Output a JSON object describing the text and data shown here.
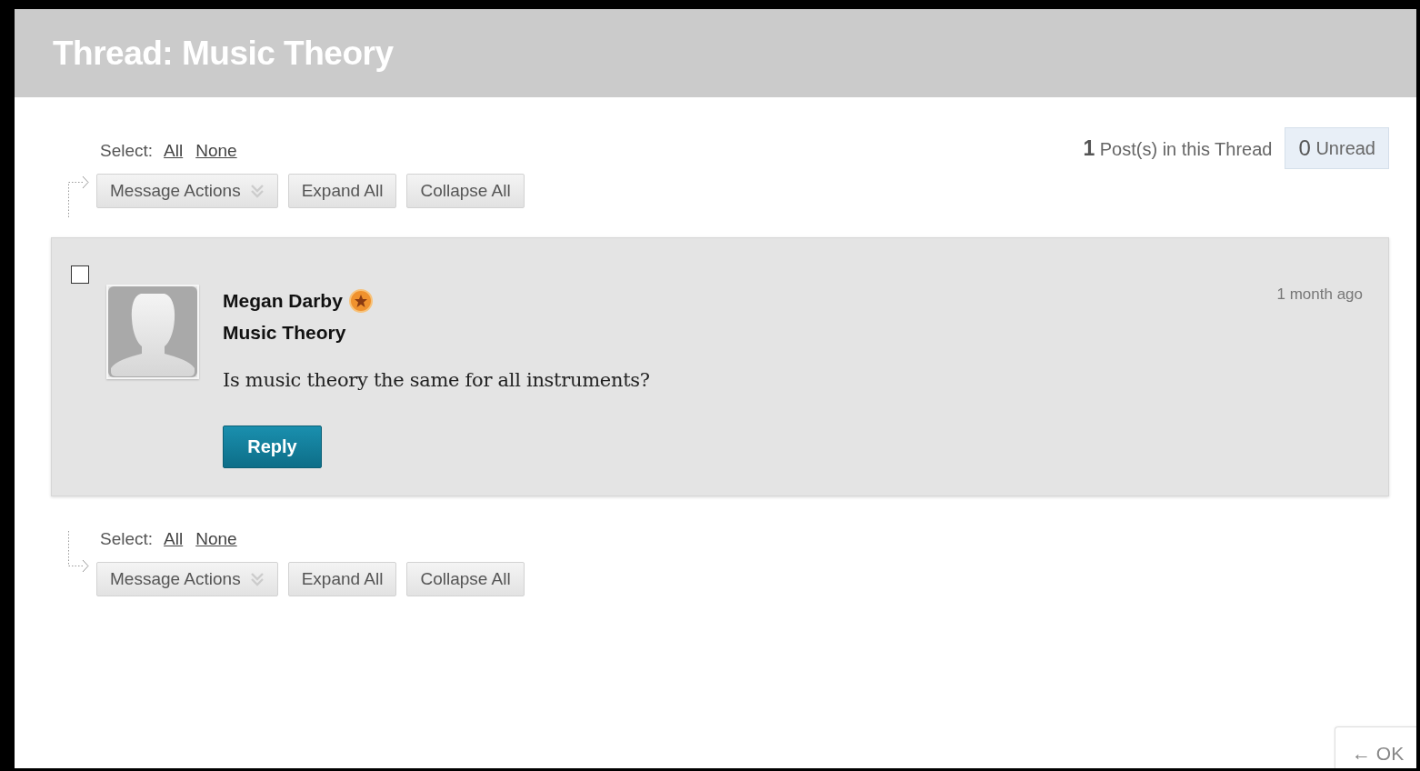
{
  "title": "Thread: Music Theory",
  "thread_info": {
    "post_count": "1",
    "post_label": "Post(s) in this Thread",
    "unread_count": "0",
    "unread_label": "Unread"
  },
  "toolbars": [
    {
      "kind": "top",
      "select_label": "Select:",
      "select_all": "All",
      "select_none": "None",
      "buttons": [
        {
          "label": "Message Actions",
          "kind": "menu"
        },
        {
          "label": "Expand All",
          "kind": "plain"
        },
        {
          "label": "Collapse All",
          "kind": "plain"
        }
      ]
    },
    {
      "kind": "bottom",
      "select_label": "Select:",
      "select_all": "All",
      "select_none": "None",
      "buttons": [
        {
          "label": "Message Actions",
          "kind": "menu"
        },
        {
          "label": "Expand All",
          "kind": "plain"
        },
        {
          "label": "Collapse All",
          "kind": "plain"
        }
      ]
    }
  ],
  "posts": [
    {
      "checked": false,
      "author": "Megan Darby",
      "subject": "Music Theory",
      "body": "Is music theory the same for all instruments?",
      "time": "1 month ago",
      "reply_label": "Reply"
    }
  ],
  "ok_button": "← OK"
}
